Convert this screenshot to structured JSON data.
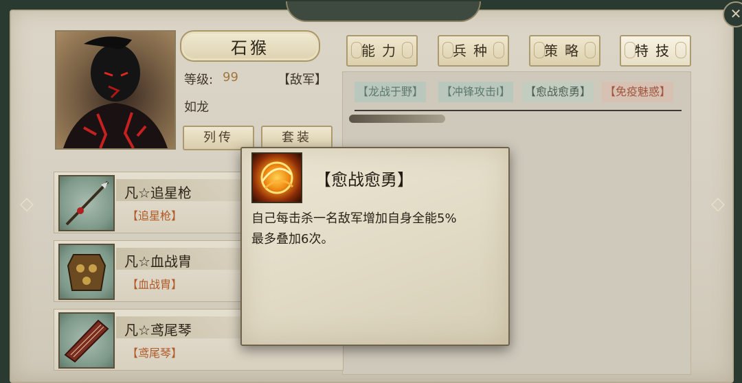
{
  "hero": {
    "name": "石猴",
    "level_label": "等级:",
    "level_value": "99",
    "faction": "【敌军】",
    "subtitle": "如龙",
    "bio_button": "列传",
    "set_button": "套装"
  },
  "tabs": [
    "能力",
    "兵种",
    "策略",
    "特技"
  ],
  "skills": [
    {
      "label": "【龙战于野】",
      "color": "#5e7a6e",
      "bg": "#b9c7bc"
    },
    {
      "label": "【冲锋攻击Ⅰ】",
      "color": "#5e7a6e",
      "bg": "#b9c7bc"
    },
    {
      "label": "【愈战愈勇】",
      "color": "#4d5f52",
      "bg": "#c2ccbf"
    },
    {
      "label": "【免疫魅惑】",
      "color": "#a2553d",
      "bg": "#d6c1b2"
    }
  ],
  "equipment": [
    {
      "name": "凡☆追星枪",
      "sub": "【追星枪】",
      "icon": "spear-icon"
    },
    {
      "name": "凡☆血战胄",
      "sub": "【血战胄】",
      "icon": "armor-icon"
    },
    {
      "name": "凡☆鸢尾琴",
      "sub": "【鸢尾琴】",
      "icon": "zither-icon"
    }
  ],
  "popup": {
    "title": "【愈战愈勇】",
    "desc_line1": "自己每击杀一名敌军增加自身全能5%",
    "desc_line2": "最多叠加6次。",
    "icon": "fire-skill-icon"
  },
  "nav": {
    "left_arrow": "◇",
    "right_arrow": "◇",
    "close": "✕"
  }
}
